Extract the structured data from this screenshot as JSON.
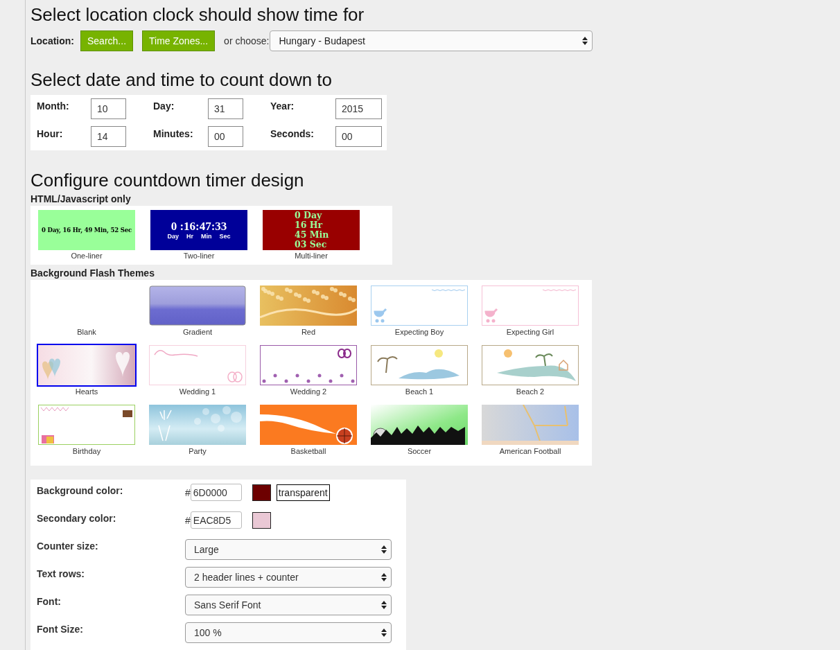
{
  "location": {
    "heading": "Select location clock should show time for",
    "label": "Location:",
    "buttons": [
      "Search...",
      "Time Zones..."
    ],
    "or_label": "or choose:",
    "select": "Hungary - Budapest"
  },
  "date": {
    "heading": "Select date and time to count down to",
    "fields": [
      {
        "label": "Month:",
        "value": "10"
      },
      {
        "label": "Day:",
        "value": "31"
      },
      {
        "label": "Year:",
        "value": "2015"
      },
      {
        "label": "Hour:",
        "value": "14"
      },
      {
        "label": "Minutes:",
        "value": "00"
      },
      {
        "label": "Seconds:",
        "value": "00"
      }
    ]
  },
  "design": {
    "heading": "Configure countdown timer design",
    "html_label": "HTML/Javascript only",
    "html_styles": [
      {
        "kind": "one-liner",
        "caption": "One-liner",
        "lines": [
          "0 Day, 16 Hr, 49 Min, 52 Sec"
        ]
      },
      {
        "kind": "two-liner",
        "caption": "Two-liner",
        "lines": [
          "0 :16:47:33"
        ],
        "units": [
          "Day",
          "Hr",
          "Min",
          "Sec"
        ]
      },
      {
        "kind": "multi-liner",
        "caption": "Multi-liner",
        "lines": [
          "0 Day",
          "16 Hr",
          "45 Min",
          "03 Sec"
        ]
      }
    ],
    "flash_label": "Background Flash Themes",
    "themes": [
      {
        "kind": "blank",
        "caption": "Blank",
        "selected": false
      },
      {
        "kind": "gradient",
        "caption": "Gradient",
        "selected": false
      },
      {
        "kind": "golden",
        "caption": "Red",
        "selected": false
      },
      {
        "kind": "boy",
        "caption": "Expecting Boy",
        "selected": false
      },
      {
        "kind": "girl",
        "caption": "Expecting Girl",
        "selected": false
      },
      {
        "kind": "hearts",
        "caption": "Hearts",
        "selected": true
      },
      {
        "kind": "wedding1",
        "caption": "Wedding 1",
        "selected": false
      },
      {
        "kind": "wedding2",
        "caption": "Wedding 2",
        "selected": false
      },
      {
        "kind": "beach1",
        "caption": "Beach 1",
        "selected": false
      },
      {
        "kind": "beach2",
        "caption": "Beach 2",
        "selected": false
      },
      {
        "kind": "birthday",
        "caption": "Birthday",
        "selected": false
      },
      {
        "kind": "party",
        "caption": "Party",
        "selected": false
      },
      {
        "kind": "basketball",
        "caption": "Basketball",
        "selected": false
      },
      {
        "kind": "soccer",
        "caption": "Soccer",
        "selected": false
      },
      {
        "kind": "football",
        "caption": "American Football",
        "selected": false
      }
    ]
  },
  "settings": {
    "colors": [
      {
        "label": "Background color:",
        "hash": "#",
        "value": "6D0000",
        "color": "#6d0000",
        "extra": "transparent"
      },
      {
        "label": "Secondary color:",
        "hash": "#",
        "value": "EAC8D5",
        "color": "#eac8d5"
      }
    ],
    "selects": [
      {
        "label": "Counter size:",
        "value": "Large"
      },
      {
        "label": "Text rows:",
        "value": "2 header lines + counter"
      },
      {
        "label": "Font:",
        "value": "Sans Serif Font"
      },
      {
        "label": "Font Size:",
        "value": "100 %"
      }
    ]
  }
}
